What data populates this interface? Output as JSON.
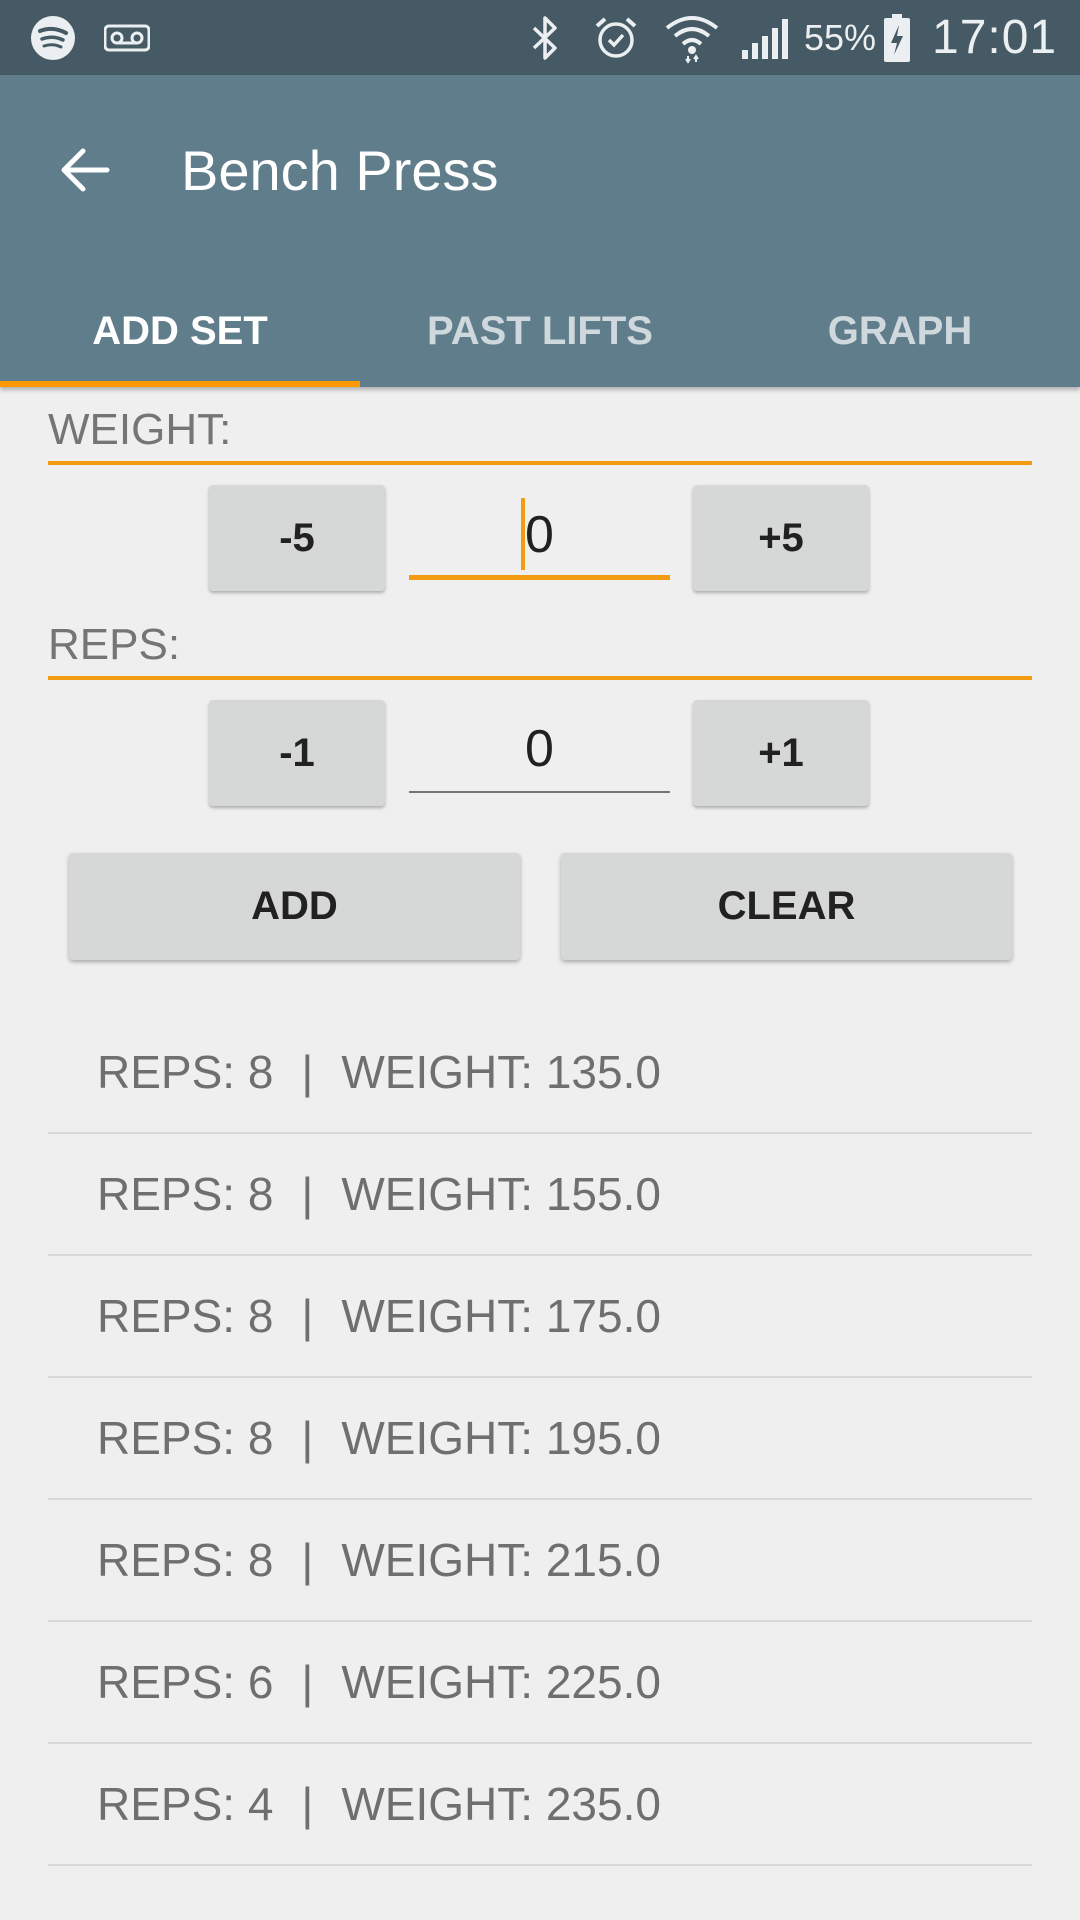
{
  "status_bar": {
    "battery_percent": "55%",
    "time": "17:01",
    "icons": [
      "spotify-icon",
      "voicemail-icon",
      "bluetooth-icon",
      "alarm-icon",
      "wifi-icon",
      "signal-icon",
      "battery-charging-icon"
    ]
  },
  "app_bar": {
    "title": "Bench Press",
    "tabs": [
      {
        "label": "ADD SET",
        "active": true
      },
      {
        "label": "PAST LIFTS",
        "active": false
      },
      {
        "label": "GRAPH",
        "active": false
      }
    ]
  },
  "weight": {
    "label": "WEIGHT:",
    "decrement_label": "-5",
    "increment_label": "+5",
    "value": "0"
  },
  "reps": {
    "label": "REPS:",
    "decrement_label": "-1",
    "increment_label": "+1",
    "value": "0"
  },
  "actions": {
    "add_label": "ADD",
    "clear_label": "CLEAR"
  },
  "sets": [
    {
      "reps_text": "REPS: 8",
      "weight_text": "WEIGHT: 135.0"
    },
    {
      "reps_text": "REPS: 8",
      "weight_text": "WEIGHT: 155.0"
    },
    {
      "reps_text": "REPS: 8",
      "weight_text": "WEIGHT: 175.0"
    },
    {
      "reps_text": "REPS: 8",
      "weight_text": "WEIGHT: 195.0"
    },
    {
      "reps_text": "REPS: 8",
      "weight_text": "WEIGHT: 215.0"
    },
    {
      "reps_text": "REPS: 6",
      "weight_text": "WEIGHT: 225.0"
    },
    {
      "reps_text": "REPS: 4",
      "weight_text": "WEIGHT: 235.0"
    }
  ],
  "separator": "|",
  "colors": {
    "status_bar": "#455a64",
    "app_bar": "#607d8b",
    "accent": "#f39c12",
    "background": "#efefef",
    "button": "#d6d7d7"
  }
}
